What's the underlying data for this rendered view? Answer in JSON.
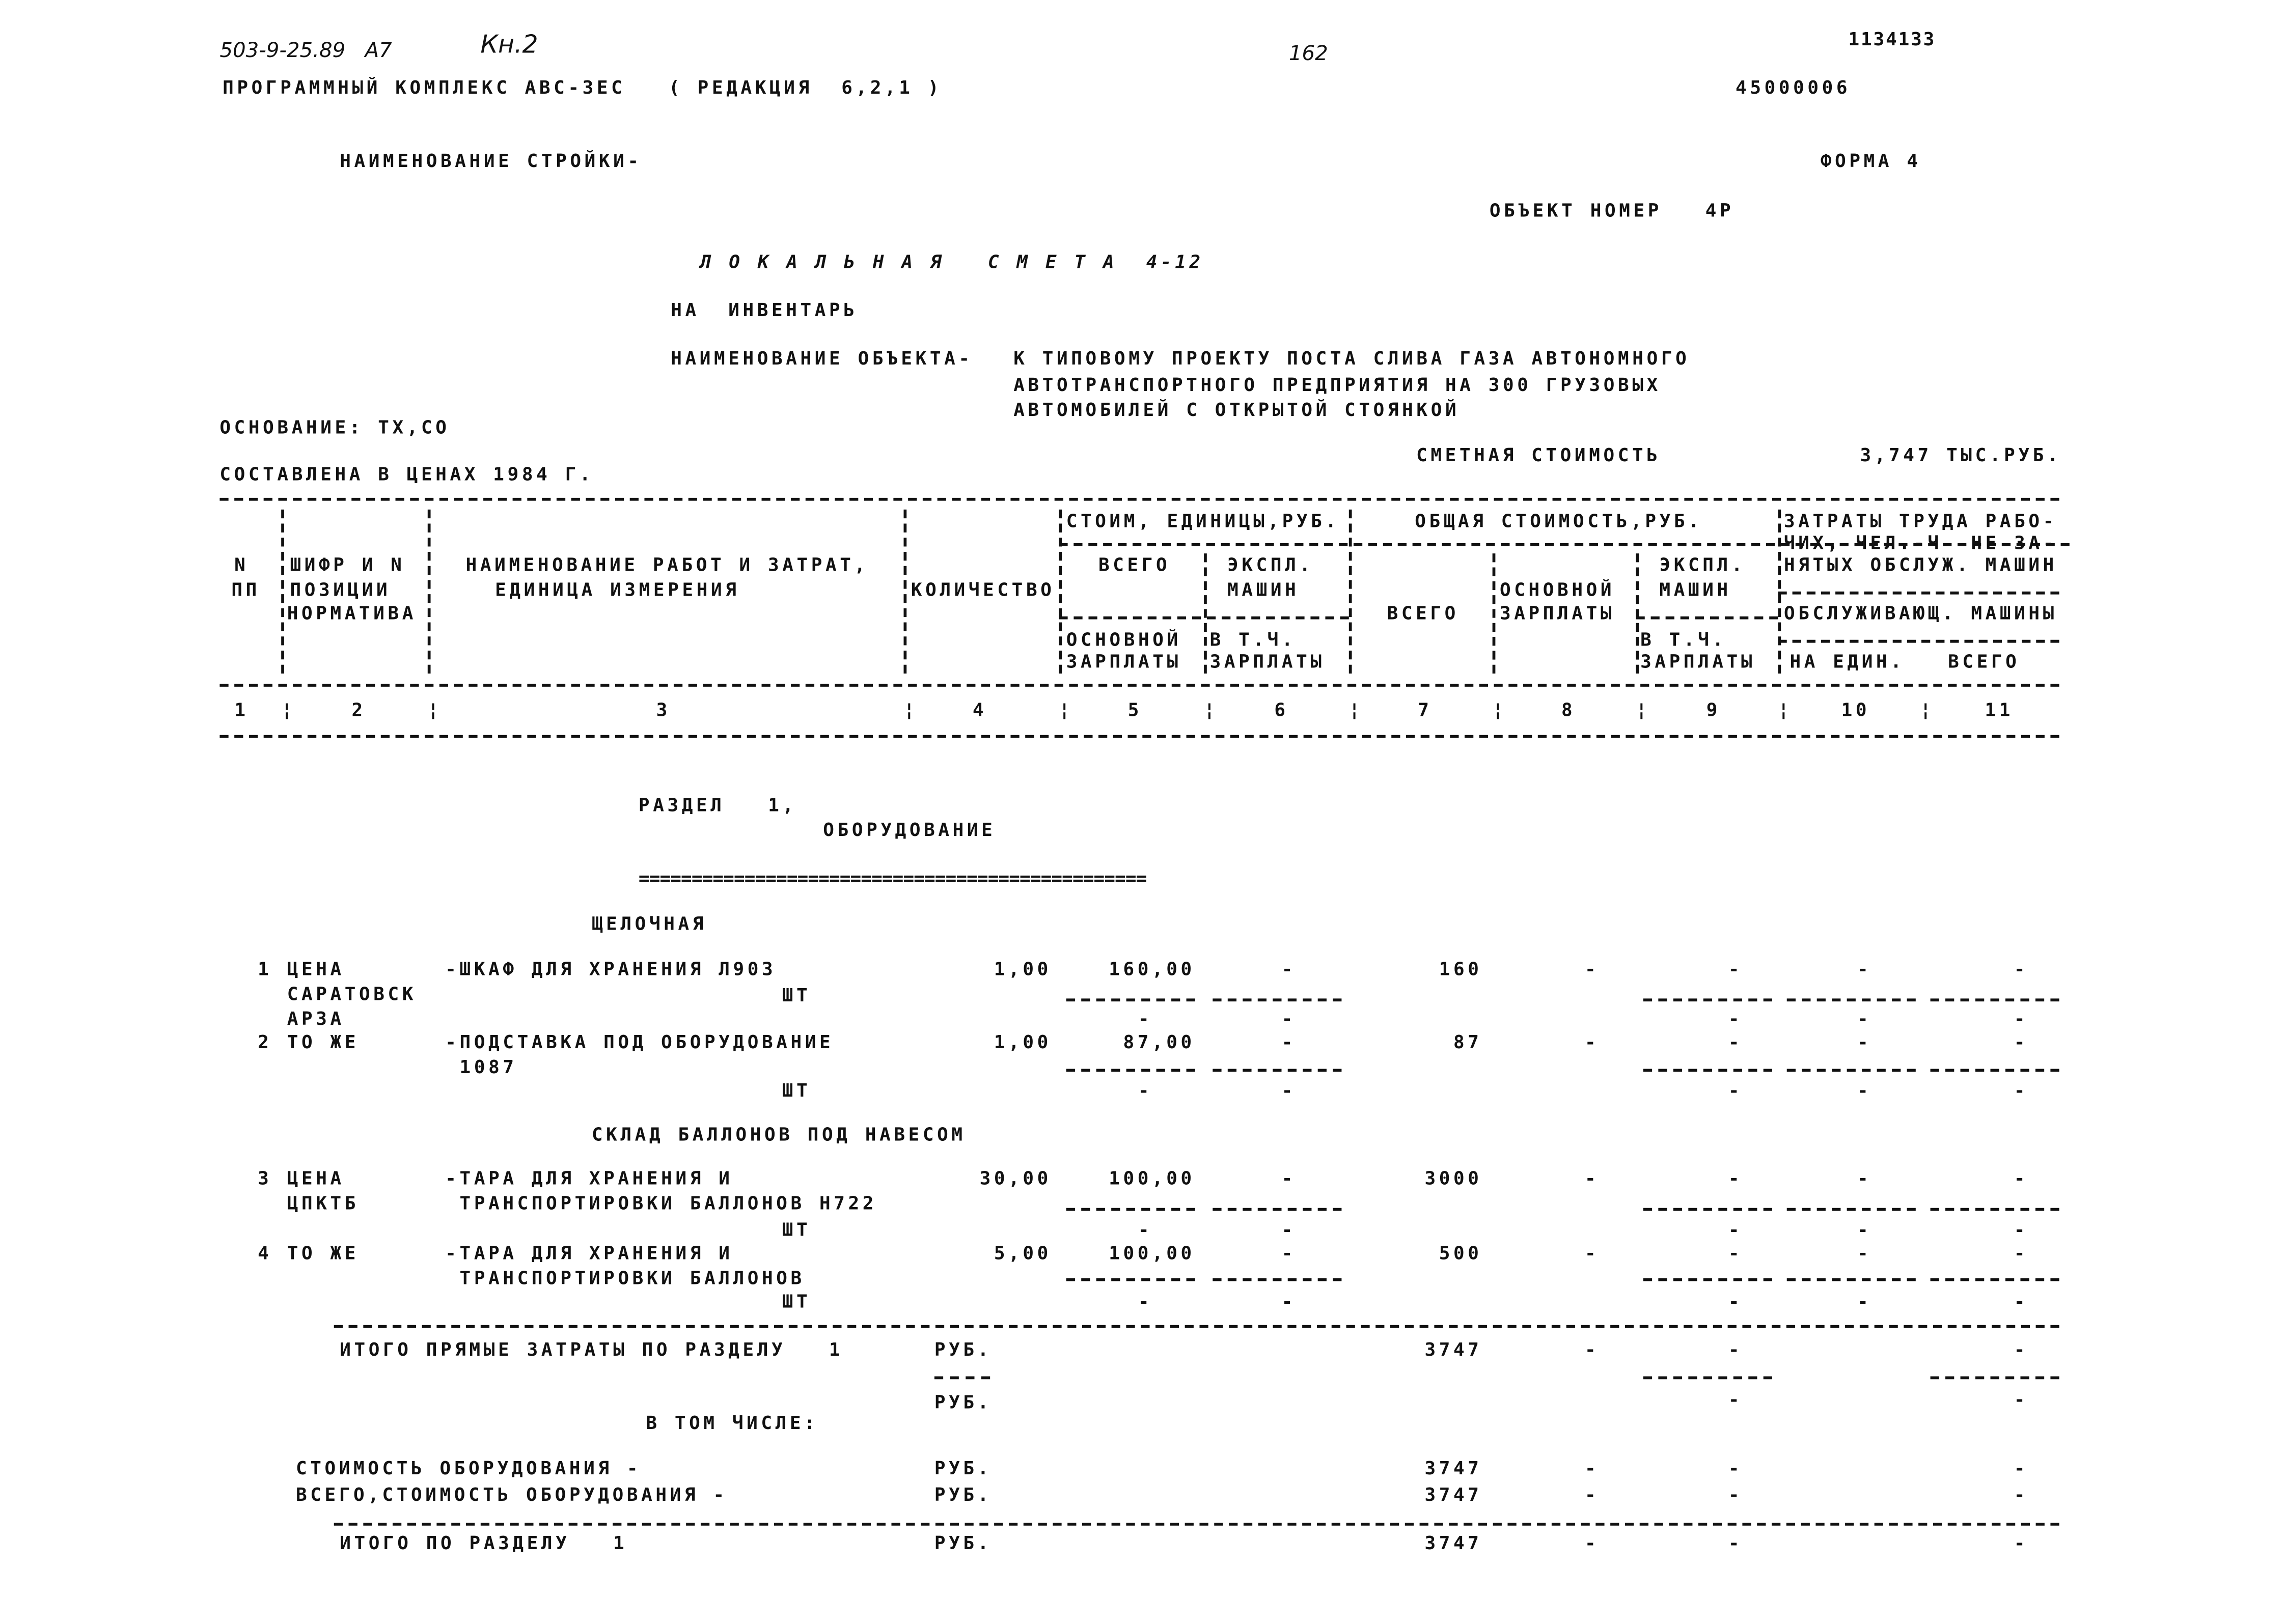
{
  "header": {
    "handwritten_code": "503-9-25.89   А7",
    "handwritten_book": "Кн.2",
    "page_number": "162",
    "sheet_code": "1134133",
    "program": "ПРОГРАММНЫЙ КОМПЛЕКС АВС-3ЕС   ( РЕДАКЦИЯ  6,2,1 )",
    "code": "45000006",
    "construction_label": "НАИМЕНОВАНИЕ СТРОЙКИ-",
    "form": "ФОРМА 4",
    "object_number": "ОБЪЕКТ НОМЕР   4Р",
    "title": "Л О К А Л Ь Н А Я   С М Е Т А  4-12",
    "subtitle": "НА  ИНВЕНТАРЬ",
    "object_label": "НАИМЕНОВАНИЕ ОБЪЕКТА-",
    "object_name": [
      "К ТИПОВОМУ ПРОЕКТУ ПОСТА СЛИВА ГАЗА АВТОНОМНОГО",
      "АВТОТРАНСПОРТНОГО ПРЕДПРИЯТИЯ НА 300 ГРУЗОВЫХ",
      "АВТОМОБИЛЕЙ С ОТКРЫТОЙ СТОЯНКОЙ"
    ],
    "basis": "ОСНОВАНИЕ: ТХ,СО",
    "prices": "СОСТАВЛЕНА В ЦЕНАХ 1984 Г.",
    "cost_label": "СМЕТНАЯ СТОИМОСТЬ",
    "cost_value": "3,747 ТЫС.РУБ."
  },
  "table_header": {
    "num": [
      "N",
      "ПП"
    ],
    "code": [
      "ШИФР И N",
      "ПОЗИЦИИ",
      "НОРМАТИВА"
    ],
    "name": [
      "НАИМЕНОВАНИЕ РАБОТ И ЗАТРАТ,",
      "ЕДИНИЦА ИЗМЕРЕНИЯ"
    ],
    "qty": "КОЛИЧЕСТВО",
    "unit_cost": "СТОИМ, ЕДИНИЦЫ,РУБ.",
    "unit_total": "ВСЕГО",
    "unit_mach": [
      "ЭКСПЛ.",
      "МАШИН"
    ],
    "unit_wage": [
      "ОСНОВНОЙ",
      "ЗАРПЛАТЫ"
    ],
    "unit_mach_wage": [
      "В Т.Ч.",
      "ЗАРПЛАТЫ"
    ],
    "total_cost": "ОБЩАЯ СТОИМОСТЬ,РУБ.",
    "total": "ВСЕГО",
    "total_wage": [
      "ОСНОВНОЙ",
      "ЗАРПЛАТЫ"
    ],
    "total_mach": [
      "ЭКСПЛ.",
      "МАШИН"
    ],
    "total_mach_wage": [
      "В Т.Ч.",
      "ЗАРПЛАТЫ"
    ],
    "labor": [
      "ЗАТРАТЫ ТРУДА РАБО-",
      "ЧИХ, ЧЕЛ.-Ч  НЕ ЗА-",
      "НЯТЫХ ОБСЛУЖ. МАШИН",
      "ОБСЛУЖИВАЮЩ. МАШИНЫ"
    ],
    "labor_unit": "НА ЕДИН.",
    "labor_total": "ВСЕГО"
  },
  "column_numbers": [
    "1",
    "2",
    "3",
    "4",
    "5",
    "6",
    "7",
    "8",
    "9",
    "10",
    "11"
  ],
  "section": {
    "label": "РАЗДЕЛ   1,",
    "name": "ОБОРУДОВАНИЕ",
    "separator": "================================================",
    "groups": [
      "ЩЕЛОЧНАЯ",
      "СКЛАД БАЛЛОНОВ ПОД НАВЕСОМ"
    ]
  },
  "rows": [
    {
      "num": "1",
      "code": [
        "ЦЕНА",
        "САРАТОВСК",
        "АРЗА"
      ],
      "name": [
        "-ШКАФ ДЛЯ ХРАНЕНИЯ Л903"
      ],
      "unit": "ШТ",
      "qty": "1,00",
      "unit_total": "160,00",
      "unit_mach": "-",
      "unit_wage": "-",
      "unit_mach_wage": "-",
      "total": "160",
      "total_wage": "-",
      "total_mach": "-",
      "total_mach_wage": "-",
      "labor_unit": "-",
      "labor_total": "-",
      "labor_unit_2": "-",
      "labor_total_2": "-"
    },
    {
      "num": "2",
      "code": [
        "ТО ЖЕ"
      ],
      "name": [
        "-ПОДСТАВКА ПОД ОБОРУДОВАНИЕ",
        " 1087"
      ],
      "unit": "ШТ",
      "qty": "1,00",
      "unit_total": "87,00",
      "unit_mach": "-",
      "unit_wage": "-",
      "unit_mach_wage": "-",
      "total": "87",
      "total_wage": "-",
      "total_mach": "-",
      "total_mach_wage": "-",
      "labor_unit": "-",
      "labor_total": "-",
      "labor_unit_2": "-",
      "labor_total_2": "-"
    },
    {
      "num": "3",
      "code": [
        "ЦЕНА",
        "ЦПКТБ"
      ],
      "name": [
        "-ТАРА ДЛЯ ХРАНЕНИЯ И",
        " ТРАНСПОРТИРОВКИ БАЛЛОНОВ Н722"
      ],
      "unit": "ШТ",
      "qty": "30,00",
      "unit_total": "100,00",
      "unit_mach": "-",
      "unit_wage": "-",
      "unit_mach_wage": "-",
      "total": "3000",
      "total_wage": "-",
      "total_mach": "-",
      "total_mach_wage": "-",
      "labor_unit": "-",
      "labor_total": "-",
      "labor_unit_2": "-",
      "labor_total_2": "-"
    },
    {
      "num": "4",
      "code": [
        "ТО ЖЕ"
      ],
      "name": [
        "-ТАРА ДЛЯ ХРАНЕНИЯ И",
        " ТРАНСПОРТИРОВКИ БАЛЛОНОВ"
      ],
      "unit": "ШТ",
      "qty": "5,00",
      "unit_total": "100,00",
      "unit_mach": "-",
      "unit_wage": "-",
      "unit_mach_wage": "-",
      "total": "500",
      "total_wage": "-",
      "total_mach": "-",
      "total_mach_wage": "-",
      "labor_unit": "-",
      "labor_total": "-",
      "labor_unit_2": "-",
      "labor_total_2": "-"
    }
  ],
  "totals": {
    "direct": {
      "label": "ИТОГО ПРЯМЫЕ ЗАТРАТЫ ПО РАЗДЕЛУ   1",
      "unit": "РУБ.",
      "unit_2": "РУБ.",
      "total": "3747",
      "total_wage": "-",
      "total_mach": "-",
      "labor_total": "-",
      "total_mach_wage": "-",
      "labor_total_2": "-"
    },
    "including_label": "В ТОМ ЧИСЛЕ:",
    "equipment": {
      "label": "СТОИМОСТЬ ОБОРУДОВАНИЯ -",
      "unit": "РУБ.",
      "total": "3747",
      "total_wage": "-",
      "total_mach": "-",
      "labor_total": "-"
    },
    "equipment_all": {
      "label": "ВСЕГО,СТОИМОСТЬ ОБОРУДОВАНИЯ -",
      "unit": "РУБ.",
      "total": "3747",
      "total_wage": "-",
      "total_mach": "-",
      "labor_total": "-"
    },
    "section_total": {
      "label": "ИТОГО ПО РАЗДЕЛУ   1",
      "unit": "РУБ.",
      "total": "3747",
      "total_wage": "-",
      "total_mach": "-",
      "labor_total": "-"
    }
  }
}
